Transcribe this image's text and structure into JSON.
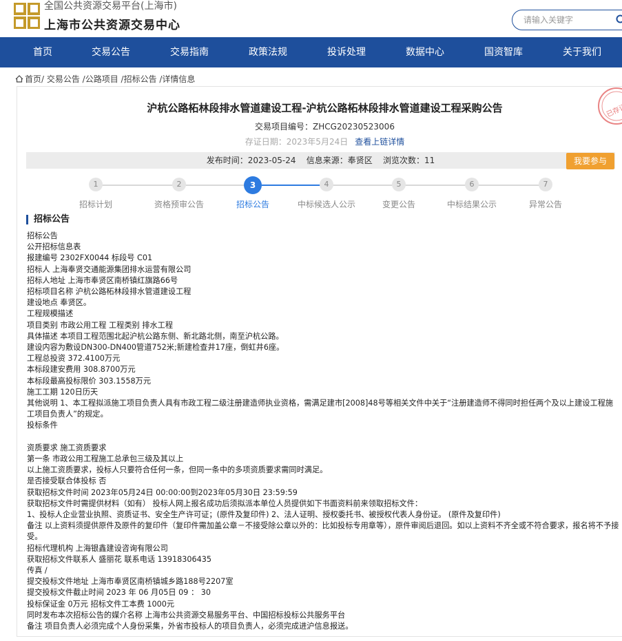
{
  "header": {
    "subtitle": "全国公共资源交易平台(上海市)",
    "title": "上海市公共资源交易中心",
    "search_placeholder": "请输入关键字"
  },
  "nav": [
    "首页",
    "交易公告",
    "交易指南",
    "政策法规",
    "投诉处理",
    "数据中心",
    "国资智库",
    "关于我们"
  ],
  "breadcrumb": "首页/ 交易公告 /公路项目 /招标公告 /详情信息",
  "article": {
    "title": "沪杭公路柘林段排水管道建设工程-沪杭公路柘林段排水管道建设工程采购公告",
    "project_no": "交易项目编号：ZHCG20230523006",
    "cert_date": "存证日期：2023年5月24日",
    "cert_link": "查看上链详情",
    "info": "发布时间：2023-05-24    信息来源：奉贤区    浏览次数：11",
    "join_button": "我要参与",
    "seal_text": "已存证"
  },
  "steps": [
    {
      "num": "1",
      "label": "招标计划"
    },
    {
      "num": "2",
      "label": "资格预审公告"
    },
    {
      "num": "3",
      "label": "招标公告"
    },
    {
      "num": "4",
      "label": "中标候选人公示"
    },
    {
      "num": "5",
      "label": "变更公告"
    },
    {
      "num": "6",
      "label": "中标结果公示"
    },
    {
      "num": "7",
      "label": "异常公告"
    }
  ],
  "current_step": 3,
  "section_title": "招标公告",
  "lines": [
    "招标公告",
    "公开招标信息表",
    "报建编号 2302FX0044 标段号 C01",
    "招标人 上海奉贤交通能源集团排水运营有限公司",
    "招标人地址 上海市奉贤区南桥镇红旗路66号",
    "招标项目名称 沪杭公路柘林段排水管道建设工程",
    "建设地点 奉贤区。",
    "工程规模描述",
    "项目类别 市政公用工程 工程类别 排水工程",
    "具体描述 本项目工程范围北起沪杭公路东侧、新北路北侧，南至沪杭公路。",
    "建设内容为敷设DN300-DN400管道752米;新建检查井17座，倒虹井6座。",
    "工程总投资 372.4100万元",
    "本标段建安费用 308.8700万元",
    "本标段最高投标限价 303.1558万元",
    "施工工期 120日历天",
    "其他说明 1、本工程拟派施工项目负责人具有市政工程二级注册建造师执业资格，需满足建市[2008]48号等相关文件中关于“注册建造师不得同时担任两个及以上建设工程施工项目负责人”的规定。",
    "投标条件",
    "",
    "资质要求 施工资质要求",
    "第一条 市政公用工程施工总承包三级及其以上",
    "以上施工资质要求，投标人只要符合任何一条，但同一条中的多项资质要求需同时满足。",
    "是否接受联合体投标 否",
    "获取招标文件时间 2023年05月24日 00:00:00到2023年05月30日 23:59:59",
    "获取招标文件时需提供材料（如有） 投标人网上报名成功后须拟派本单位人员提供如下书面资料前来领取招标文件：",
    "1、投标人企业营业执照、资质证书、安全生产许可证；(原件及复印件) 2、法人证明、授权委托书、被授权代表人身份证。 (原件及复印件)",
    "备注 以上资料须提供原件及原件的复印件（复印件需加盖公章－不接受除公章以外的：比如投标专用章等），原件审阅后退回。如以上资料不齐全或不符合要求，报名将不予接受。",
    "招标代理机构 上海银鑫建设咨询有限公司",
    "获取招标文件联系人 盛丽花 联系电话 13918306435",
    "传真 /",
    "提交投标文件地址 上海市奉贤区南桥镇城乡路188号2207室",
    "提交投标文件截止时间 2023 年 06 月05日 09 ： 30",
    "投标保证金 0万元 招标文件工本费 1000元",
    "同时发布本次招标公告的媒介名称 上海市公共资源交易服务平台、中国招标投标公共服务平台",
    "备注 项目负责人必须完成个人身份采集，外省市投标人的项目负责人，必须完成进沪信息报送。"
  ]
}
